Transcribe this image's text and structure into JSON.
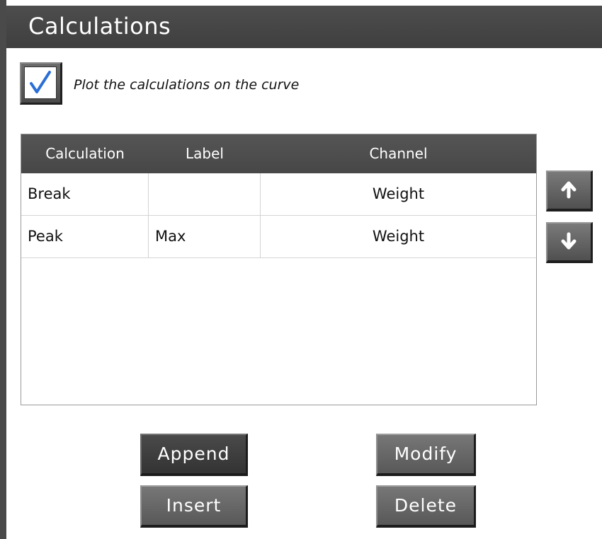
{
  "window": {
    "title": "Calculations"
  },
  "plot_option": {
    "checked": true,
    "label": "Plot the calculations on the curve"
  },
  "table": {
    "columns": [
      "Calculation",
      "Label",
      "Channel"
    ],
    "rows": [
      {
        "calculation": "Break",
        "label": "",
        "channel": "Weight"
      },
      {
        "calculation": "Peak",
        "label": "Max",
        "channel": "Weight"
      }
    ]
  },
  "reorder": {
    "up_icon": "arrow-up-icon",
    "down_icon": "arrow-down-icon"
  },
  "actions": {
    "append": "Append",
    "insert": "Insert",
    "modify": "Modify",
    "delete": "Delete"
  },
  "colors": {
    "header_bg": "#454545",
    "button_bg": "#666666",
    "button_text": "#ffffff"
  }
}
